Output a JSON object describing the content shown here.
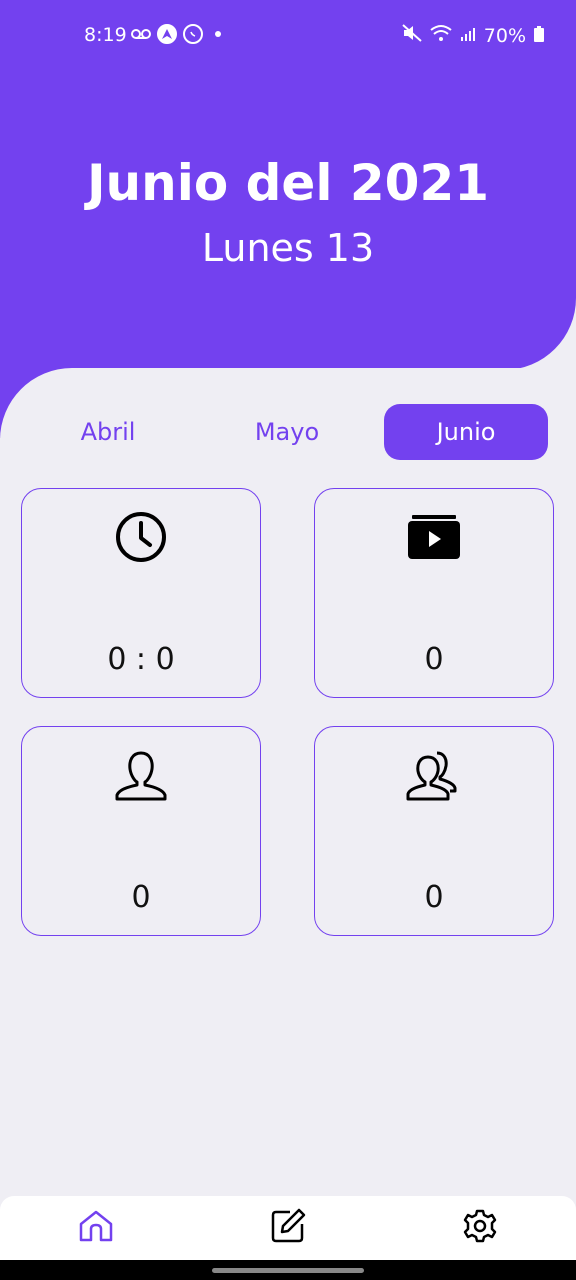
{
  "status_bar": {
    "time": "8:19",
    "battery": "70%",
    "icons": [
      "voicemail-icon",
      "navigation-app-icon",
      "whatsapp-icon",
      "mute-icon",
      "wifi-icon",
      "signal-icon",
      "battery-icon"
    ]
  },
  "header": {
    "title": "Junio del 2021",
    "subtitle": "Lunes 13",
    "color": "#7341ef"
  },
  "tabs": [
    {
      "label": "Abril",
      "active": false
    },
    {
      "label": "Mayo",
      "active": false
    },
    {
      "label": "Junio",
      "active": true
    }
  ],
  "cards": [
    {
      "icon": "clock-icon",
      "value": "0 : 0"
    },
    {
      "icon": "video-folder-icon",
      "value": "0"
    },
    {
      "icon": "person-icon",
      "value": "0"
    },
    {
      "icon": "people-icon",
      "value": "0"
    }
  ],
  "bottom_nav": [
    {
      "icon": "home-icon",
      "active": true
    },
    {
      "icon": "edit-icon",
      "active": false
    },
    {
      "icon": "settings-icon",
      "active": false
    }
  ]
}
